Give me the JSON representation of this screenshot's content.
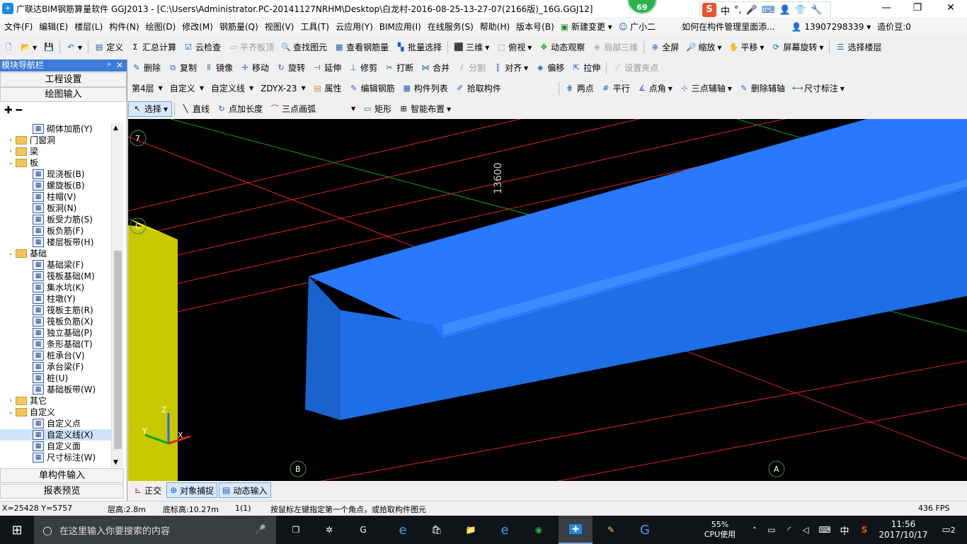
{
  "window": {
    "title": "广联达BIM钢筋算量软件 GGJ2013 - [C:\\Users\\Administrator.PC-20141127NRHM\\Desktop\\白龙村-2016-08-25-13-27-07(2166版)_16G.GGJ12]",
    "badge": "69",
    "ime_label": "中"
  },
  "menu": [
    "文件(F)",
    "编辑(E)",
    "楼层(L)",
    "构件(N)",
    "绘图(D)",
    "修改(M)",
    "钢筋量(Q)",
    "视图(V)",
    "工具(T)",
    "云应用(Y)",
    "BIM应用(I)",
    "在线服务(S)",
    "帮助(H)",
    "版本号(B)",
    "新建变更",
    "广小二",
    "如何在构件管理里面添...",
    "13907298339",
    "造价豆:0"
  ],
  "toolbar1": [
    "定义",
    "汇总计算",
    "云检查",
    "平齐板顶",
    "查找图元",
    "查看钢筋量",
    "批量选择",
    "三维",
    "俯视",
    "动态观察",
    "局部三维",
    "全屏",
    "缩放",
    "平移",
    "屏幕旋转",
    "选择楼层"
  ],
  "toolbar2": [
    "删除",
    "复制",
    "镜像",
    "移动",
    "旋转",
    "延伸",
    "修剪",
    "打断",
    "合并",
    "分割",
    "对齐",
    "偏移",
    "拉伸",
    "设置夹点"
  ],
  "toolbar3": {
    "floor": "第4层",
    "category": "自定义",
    "type": "自定义线",
    "component": "ZDYX-23",
    "items": [
      "属性",
      "编辑钢筋",
      "构件列表",
      "拾取构件"
    ],
    "aux": [
      "两点",
      "平行",
      "点角",
      "三点辅轴",
      "删除辅轴",
      "尺寸标注"
    ]
  },
  "toolbar4": [
    "选择",
    "直线",
    "点加长度",
    "三点画弧",
    "矩形",
    "智能布置"
  ],
  "sidebar": {
    "header": "模块导航栏",
    "tabs": [
      "工程设置",
      "绘图输入"
    ],
    "bottom_tabs": [
      "单构件输入",
      "报表预览"
    ],
    "tree": [
      {
        "label": "砌体加筋(Y)",
        "level": 2
      },
      {
        "label": "门窗洞",
        "level": 0,
        "folder": true,
        "expanded": false
      },
      {
        "label": "梁",
        "level": 0,
        "folder": true,
        "expanded": false
      },
      {
        "label": "板",
        "level": 0,
        "folder": true,
        "expanded": true
      },
      {
        "label": "现浇板(B)",
        "level": 1
      },
      {
        "label": "螺旋板(B)",
        "level": 1
      },
      {
        "label": "柱帽(V)",
        "level": 1
      },
      {
        "label": "板洞(N)",
        "level": 1
      },
      {
        "label": "板受力筋(S)",
        "level": 1
      },
      {
        "label": "板负筋(F)",
        "level": 1
      },
      {
        "label": "楼层板带(H)",
        "level": 1
      },
      {
        "label": "基础",
        "level": 0,
        "folder": true,
        "expanded": true
      },
      {
        "label": "基础梁(F)",
        "level": 1
      },
      {
        "label": "筏板基础(M)",
        "level": 1
      },
      {
        "label": "集水坑(K)",
        "level": 1
      },
      {
        "label": "柱墩(Y)",
        "level": 1
      },
      {
        "label": "筏板主筋(R)",
        "level": 1
      },
      {
        "label": "筏板负筋(X)",
        "level": 1
      },
      {
        "label": "独立基础(P)",
        "level": 1
      },
      {
        "label": "条形基础(T)",
        "level": 1
      },
      {
        "label": "桩承台(V)",
        "level": 1
      },
      {
        "label": "承台梁(F)",
        "level": 1
      },
      {
        "label": "桩(U)",
        "level": 1
      },
      {
        "label": "基础板带(W)",
        "level": 1
      },
      {
        "label": "其它",
        "level": 0,
        "folder": true,
        "expanded": false
      },
      {
        "label": "自定义",
        "level": 0,
        "folder": true,
        "expanded": true
      },
      {
        "label": "自定义点",
        "level": 1
      },
      {
        "label": "自定义线(X)",
        "level": 1,
        "selected": true
      },
      {
        "label": "自定义面",
        "level": 1
      },
      {
        "label": "尺寸标注(W)",
        "level": 1
      }
    ]
  },
  "viewport": {
    "axis_labels": [
      "7",
      "C",
      "B",
      "A"
    ],
    "dimension": "13600",
    "axes": [
      "Z",
      "Y",
      "X"
    ]
  },
  "bottom": [
    "正交",
    "对象捕捉",
    "动态输入"
  ],
  "status": {
    "coords": "X=25428 Y=5757",
    "floor_height": "层高:2.8m",
    "bottom_height": "底标高:10.27m",
    "count": "1(1)",
    "hint": "按鼠标左键指定第一个角点，或拾取构件图元",
    "fps": "436 FPS"
  },
  "taskbar": {
    "search_placeholder": "在这里输入你要搜索的内容",
    "cpu": "55%",
    "cpu_label": "CPU使用",
    "ime": "中",
    "time": "11:56",
    "date": "2017/10/17",
    "notif": "2"
  },
  "colors": {
    "beam": "#1e6fe6",
    "column": "#c8c800",
    "grid_red": "#e02020",
    "grid_green": "#12a012",
    "accent": "#3b7dd8"
  }
}
